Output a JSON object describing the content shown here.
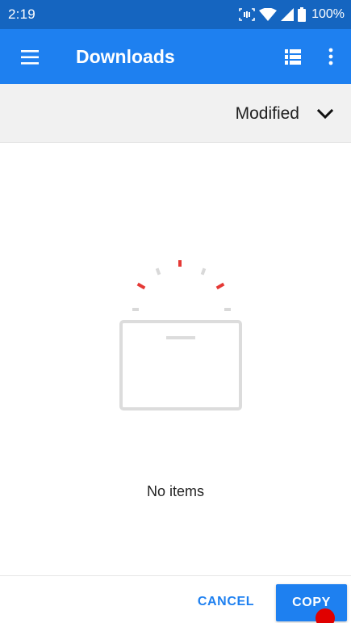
{
  "status_bar": {
    "time": "2:19",
    "battery_percent": "100%",
    "icons": [
      "screen-capture-icon",
      "wifi-icon",
      "cellular-signal-icon",
      "battery-icon"
    ]
  },
  "app_bar": {
    "title": "Downloads",
    "menu_icon": "hamburger-menu-icon",
    "view_icon": "list-view-icon",
    "more_icon": "more-vert-icon"
  },
  "sort": {
    "label": "Modified",
    "icon": "chevron-down-icon"
  },
  "empty_state": {
    "message": "No items",
    "illustration": "empty-box-illustration"
  },
  "actions": {
    "cancel_label": "CANCEL",
    "copy_label": "COPY"
  },
  "colors": {
    "status_bar": "#1565c0",
    "app_bar": "#1e80f0",
    "accent": "#1e80f0",
    "sort_bar": "#f1f1f1",
    "illustration_red": "#e53935",
    "illustration_gray": "#d9d9d9",
    "touch_marker": "#e00000"
  }
}
